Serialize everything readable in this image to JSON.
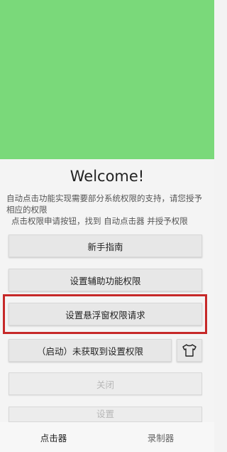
{
  "welcome": "Welcome!",
  "description_line1": "自动点击功能实现需要部分系统权限的支持，请您授予相应的权限",
  "description_line2": "点击权限申请按钮，找到 自动点击器 并授予权限",
  "buttons": {
    "guide": "新手指南",
    "accessibility": "设置辅助功能权限",
    "floating_window": "设置悬浮窗权限请求",
    "start": "（启动）未获取到设置权限",
    "close": "关闭",
    "settings": "设置"
  },
  "icons": {
    "theme": "shirt-icon"
  },
  "colors": {
    "banner": "#7ad97a",
    "highlight": "#c62828"
  },
  "tabs": [
    {
      "label": "点击器",
      "active": true
    },
    {
      "label": "录制器",
      "active": false
    }
  ]
}
